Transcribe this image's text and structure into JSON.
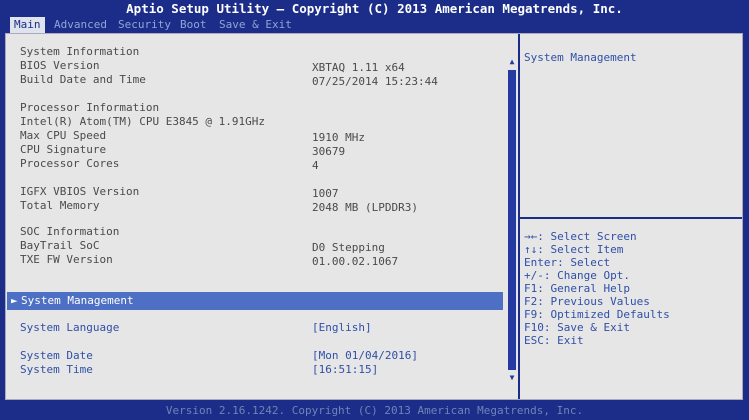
{
  "title": "Aptio Setup Utility – Copyright (C) 2013 American Megatrends, Inc.",
  "tabs": [
    "Main",
    "Advanced",
    "Security",
    "Boot",
    "Save & Exit"
  ],
  "main": {
    "system_information": "System Information",
    "bios_version_label": "BIOS Version",
    "bios_version_value": "XBTAQ 1.11 x64",
    "build_date_label": "Build Date and Time",
    "build_date_value": "07/25/2014 15:23:44",
    "processor_information": "Processor Information",
    "cpu_name": "Intel(R) Atom(TM) CPU E3845 @ 1.91GHz",
    "max_cpu_speed_label": "Max CPU Speed",
    "max_cpu_speed_value": "1910 MHz",
    "cpu_signature_label": "CPU Signature",
    "cpu_signature_value": "30679",
    "processor_cores_label": "Processor Cores",
    "processor_cores_value": "4",
    "igfx_label": "IGFX VBIOS Version",
    "igfx_value": "1007",
    "total_memory_label": "Total Memory",
    "total_memory_value": "2048 MB (LPDDR3)",
    "soc_information": "SOC Information",
    "baytrail_label": "BayTrail SoC",
    "baytrail_value": "D0 Stepping",
    "txe_label": "TXE FW Version",
    "txe_value": "01.00.02.1067",
    "system_management": "System Management",
    "system_language_label": "System Language",
    "system_language_value": "[English]",
    "system_date_label": "System Date",
    "system_date_value": "[Mon 01/04/2016]",
    "system_time_label": "System Time",
    "system_time_value": "[16:51:15]"
  },
  "help": {
    "description": "System Management",
    "keys": [
      "→←: Select Screen",
      "↑↓: Select Item",
      "Enter: Select",
      "+/-: Change Opt.",
      "F1: General Help",
      "F2: Previous Values",
      "F9: Optimized Defaults",
      "F10: Save & Exit",
      "ESC: Exit"
    ]
  },
  "footer": "Version 2.16.1242. Copyright (C) 2013 American Megatrends, Inc.",
  "colors": {
    "background": "#1b2d88",
    "panel": "#e6e6e6",
    "highlight": "#4d6fc4",
    "accent_text": "#2f4fa8"
  }
}
